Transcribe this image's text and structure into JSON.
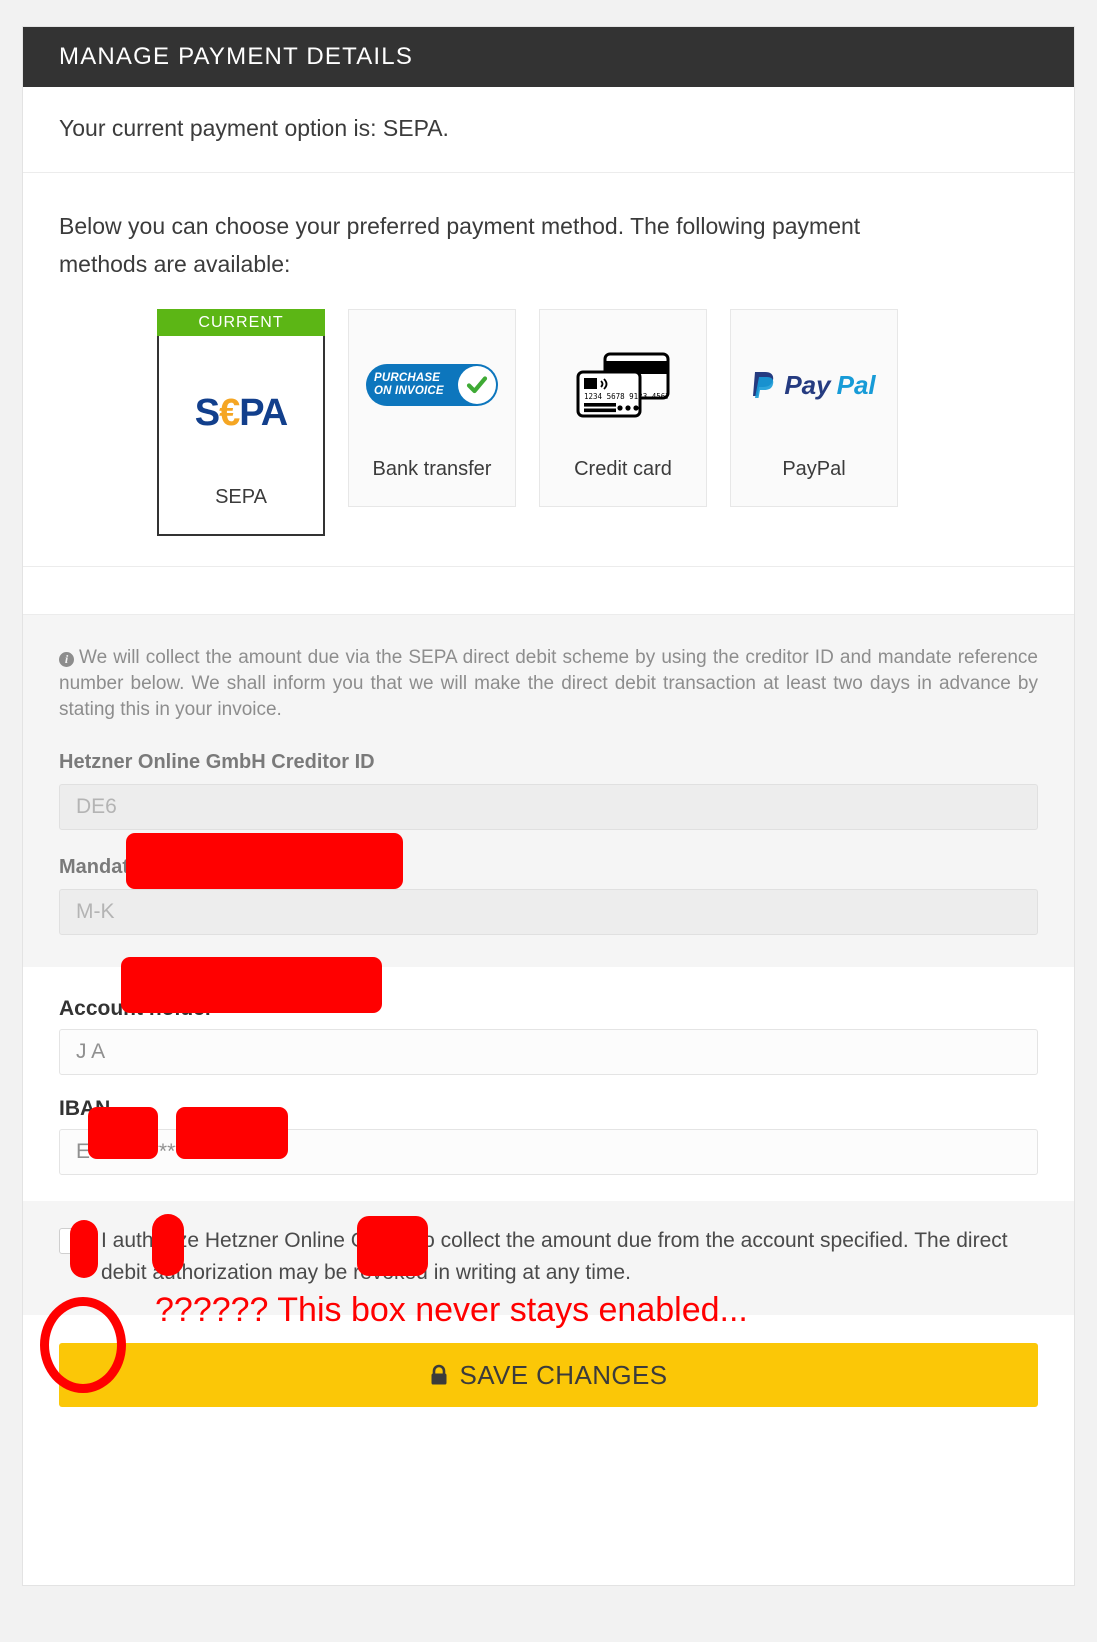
{
  "panel": {
    "header_title": "MANAGE PAYMENT DETAILS"
  },
  "current_status": {
    "prefix": "Your current payment option is: ",
    "value": "SEPA",
    "suffix": ".",
    "value_color": "#5cb615"
  },
  "choose": {
    "intro": "Below you can choose your preferred payment method. The following payment methods are available:",
    "current_badge": "CURRENT",
    "methods": [
      {
        "label": "SEPA",
        "icon": "sepa-logo",
        "current": true
      },
      {
        "label": "Bank transfer",
        "icon": "purchase-on-invoice-badge",
        "current": false
      },
      {
        "label": "Credit card",
        "icon": "credit-card-icon",
        "current": false
      },
      {
        "label": "PayPal",
        "icon": "paypal-logo",
        "current": false
      }
    ],
    "sepa_logo": {
      "part1": "S",
      "euro": "€",
      "part2": "PA"
    },
    "poi_line1": "PURCHASE",
    "poi_line2": "ON INVOICE",
    "paypal_pay": "Pay",
    "paypal_pal": "Pal",
    "card_number": "1234 5678 9123 4567"
  },
  "sepa_info": {
    "notice": "We will collect the amount due via the SEPA direct debit scheme by using the creditor ID and mandate reference number below. We shall inform you that we will make the direct debit transaction at least two days in advance by stating this in your invoice.",
    "creditor_id_label": "Hetzner Online GmbH Creditor ID",
    "creditor_id_value": "DE6",
    "mandate_ref_label": "Mandate Reference",
    "mandate_ref_value": "M-K"
  },
  "account": {
    "holder_label": "Account holder",
    "holder_value": "J                A",
    "iban_label": "IBAN",
    "iban_value": "E96 9    * **** **** **** *"
  },
  "authorization": {
    "text": "I authorize Hetzner Online GmbH to collect the amount due from the account specified. The direct debit authorization may be revoked in writing at any time.",
    "checked": false
  },
  "footer": {
    "save_label": "SAVE CHANGES",
    "save_icon": "lock-icon",
    "save_color": "#fbc707"
  },
  "annotations": {
    "note": "?????? This box never stays enabled...",
    "note_color": "#ff0000",
    "circle": "red-circle-highlight",
    "redaction_color": "#ff0000"
  }
}
